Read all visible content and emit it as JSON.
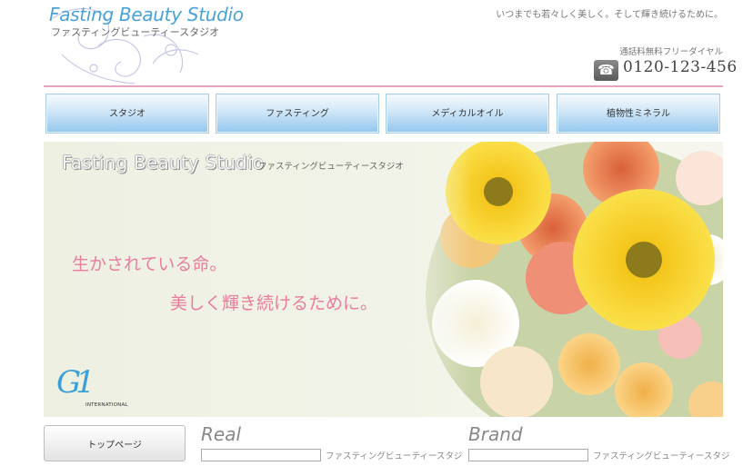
{
  "header": {
    "logo_title": "Fasting Beauty Studio",
    "logo_subtitle": "ファスティングビューティースタジオ",
    "tagline": "いつまでも若々しく美しく。そして輝き続けるために。",
    "free_dial_label": "通話料無料フリーダイヤル",
    "phone_icon": "phone-icon",
    "phone_number": "0120-123-456"
  },
  "nav": {
    "items": [
      {
        "label": "スタジオ"
      },
      {
        "label": "ファスティング"
      },
      {
        "label": "メディカルオイル"
      },
      {
        "label": "植物性ミネラル"
      }
    ]
  },
  "hero": {
    "title": "Fasting Beauty Studio",
    "title_jp": "ファスティングビューティースタジオ",
    "copy_line1": "生かされている命。",
    "copy_line2": "美しく輝き続けるために。",
    "logo_mark": "G1",
    "logo_mark_sub": "INTERNATIONAL"
  },
  "sidebar": {
    "top_page_label": "トップページ"
  },
  "sections": [
    {
      "title": "Real",
      "subtitle": "ファスティングビューティースタジ"
    },
    {
      "title": "Brand",
      "subtitle": "ファスティングビューティースタジ"
    }
  ],
  "colors": {
    "accent_blue": "#4aa3d8",
    "accent_pink": "#ea7c9e",
    "rule_pink": "#e9a3bf"
  }
}
